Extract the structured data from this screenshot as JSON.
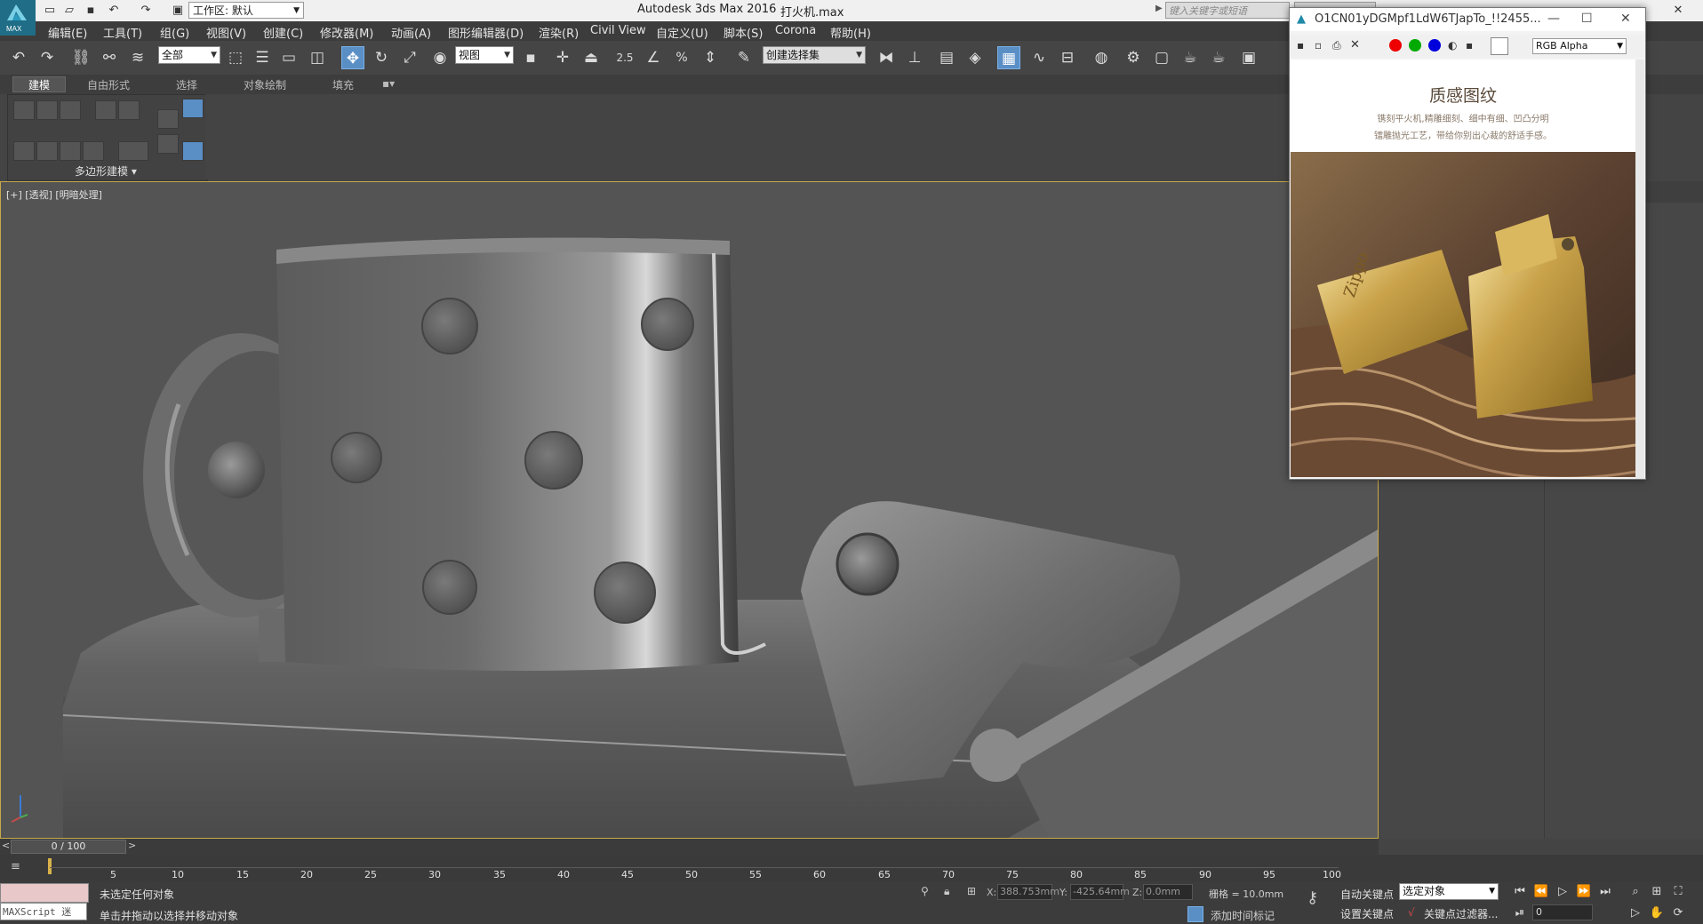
{
  "title_bar": {
    "app_title": "Autodesk 3ds Max 2016",
    "file_title": "打火机.max",
    "workspace_label": "工作区: 默认",
    "search_placeholder": "键入关键字或短语",
    "logo_text": "MAX"
  },
  "menus": [
    "编辑(E)",
    "工具(T)",
    "组(G)",
    "视图(V)",
    "创建(C)",
    "修改器(M)",
    "动画(A)",
    "图形编辑器(D)",
    "渲染(R)",
    "Civil View",
    "自定义(U)",
    "脚本(S)",
    "Corona",
    "帮助(H)"
  ],
  "toolbar": {
    "filter_value": "全部",
    "coord_system_value": "视图",
    "selection_set_value": "创建选择集",
    "snap_angle_label": "2.5",
    "snap_percent_label": "%"
  },
  "ribbon": {
    "tabs": [
      "建模",
      "自由形式",
      "选择",
      "对象绘制",
      "填充"
    ],
    "panel_label": "多边形建模"
  },
  "viewport": {
    "label": "[+] [透视] [明暗处理]"
  },
  "vfb": {
    "title": "O1CN01yDGMpf1LdW6TJapTo_!!2455...",
    "channel": "RGB Alpha",
    "image_title": "质感图纹",
    "image_sub1": "镌刻平火机,精雕细刻、细中有细、凹凸分明",
    "image_sub2": "镭雕抛光工艺，带给你别出心裁的舒适手感。",
    "lighter_brand": "Zippo"
  },
  "timeline": {
    "slider_label": "0 / 100",
    "ticks": [
      "5",
      "10",
      "15",
      "20",
      "25",
      "30",
      "35",
      "40",
      "45",
      "50",
      "55",
      "60",
      "65",
      "70",
      "75",
      "80",
      "85",
      "90",
      "95",
      "100"
    ]
  },
  "status": {
    "maxscript_label": "MAXScript 迷",
    "line1": "未选定任何对象",
    "line2": "单击并拖动以选择并移动对象",
    "x_label": "X:",
    "x_value": "388.753mm",
    "y_label": "Y:",
    "y_value": "-425.64mm",
    "z_label": "Z:",
    "z_value": "0.0mm",
    "grid": "栅格 = 10.0mm",
    "add_time_tag": "添加时间标记",
    "auto_key": "自动关键点",
    "set_key": "设置关键点",
    "selection_dropdown": "选定对象",
    "key_filters": "关键点过滤器...",
    "frame_value": "0"
  }
}
